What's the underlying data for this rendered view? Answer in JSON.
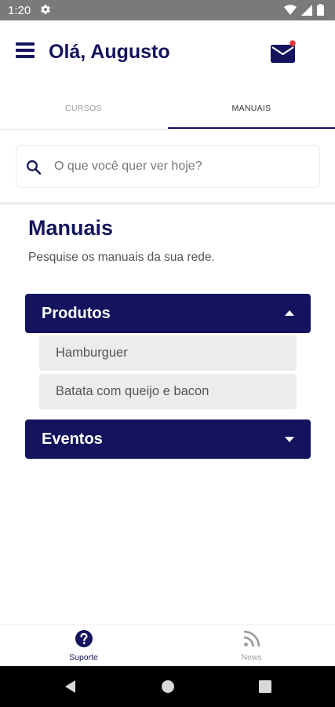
{
  "status_bar": {
    "time": "1:20",
    "icons": [
      "settings-icon",
      "wifi-icon",
      "signal-icon",
      "battery-icon"
    ]
  },
  "header": {
    "greeting": "Olá, Augusto",
    "menu_icon": "hamburger-menu-icon",
    "mail_icon": "mail-icon",
    "mail_badge_color": "#e53935"
  },
  "tabs": [
    {
      "label": "CURSOS",
      "active": false
    },
    {
      "label": "MANUAIS",
      "active": true
    }
  ],
  "search": {
    "placeholder": "O que você quer ver hoje?",
    "value": ""
  },
  "main": {
    "title": "Manuais",
    "subtitle": "Pesquise os manuais da sua rede."
  },
  "accordions": [
    {
      "label": "Produtos",
      "expanded": true,
      "items": [
        "Hamburguer",
        "Batata com queijo e bacon"
      ]
    },
    {
      "label": "Eventos",
      "expanded": false,
      "items": []
    }
  ],
  "bottom_nav": [
    {
      "label": "Suporte",
      "icon": "help-circle-icon",
      "active": true
    },
    {
      "label": "News",
      "icon": "rss-feed-icon",
      "active": false
    }
  ],
  "colors": {
    "primary": "#14145e",
    "muted": "#9e9e9e",
    "item_bg": "#ececec"
  }
}
